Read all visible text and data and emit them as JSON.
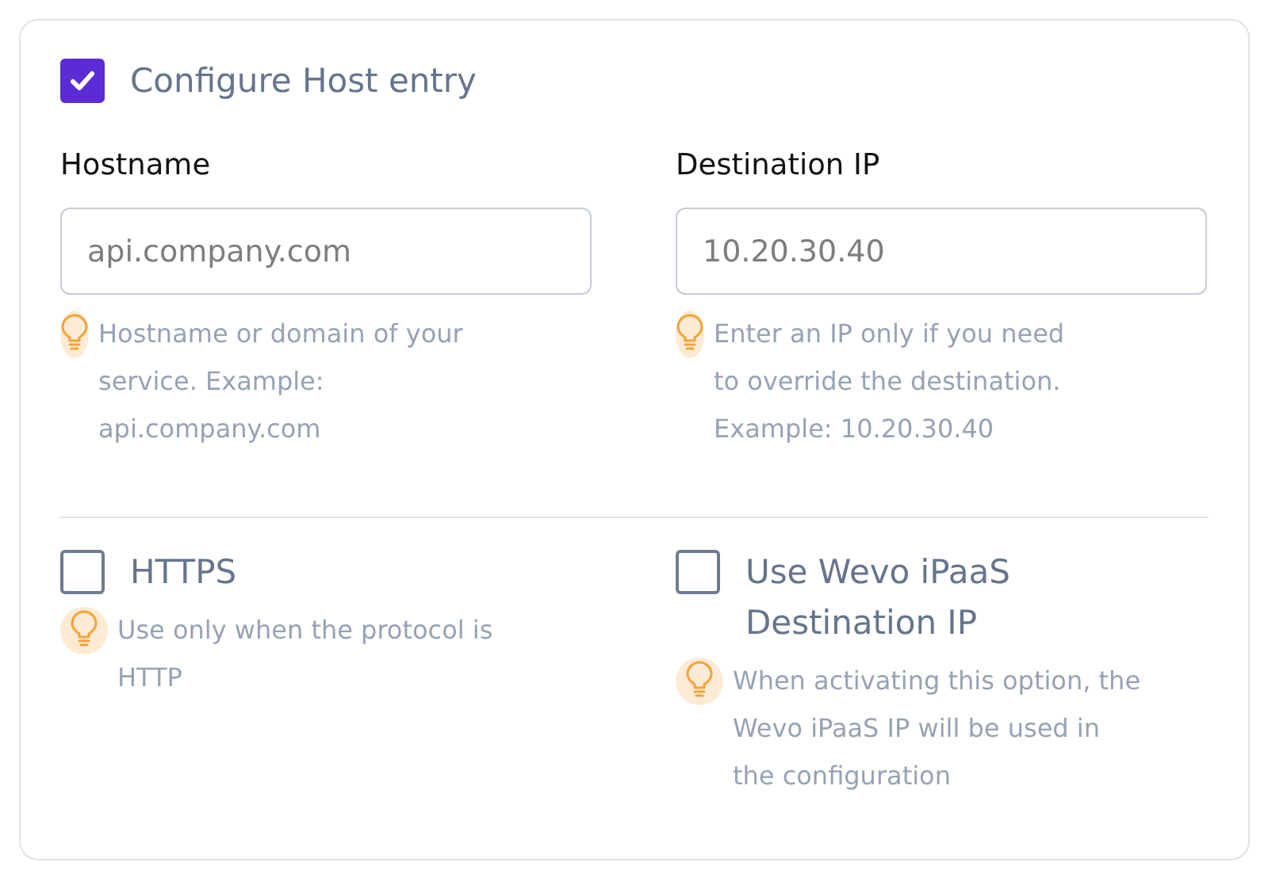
{
  "host_entry": {
    "label": "Configure Host entry",
    "checked": true
  },
  "fields": [
    {
      "label": "Hostname",
      "placeholder": "api.company.com",
      "hint": "Hostname or domain of your service. Example: api.company.com"
    },
    {
      "label": "Destination IP",
      "placeholder": "10.20.30.40",
      "hint": "Enter an IP only if you need to override the destination. Example: 10.20.30.40"
    }
  ],
  "options": [
    {
      "label": "HTTPS",
      "checked": false,
      "hint": "Use only when the protocol is HTTP"
    },
    {
      "label": "Use Wevo iPaaS Destination IP",
      "checked": false,
      "hint": "When activating this option, the Wevo iPaaS IP will be used in the configuration"
    }
  ]
}
